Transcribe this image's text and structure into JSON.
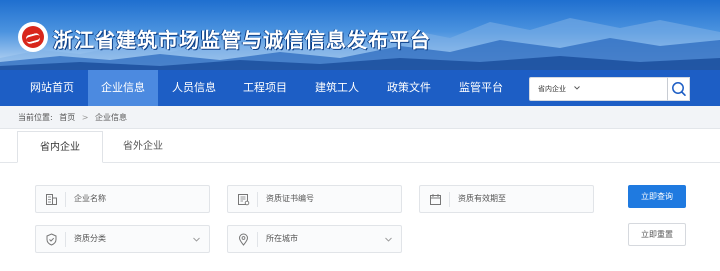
{
  "header": {
    "site_title": "浙江省建筑市场监管与诚信信息发布平台",
    "logo_icon": "zhejiang-emblem-icon",
    "brand_color": "#1d5ec5"
  },
  "nav": {
    "items": [
      {
        "label": "网站首页",
        "active": false
      },
      {
        "label": "企业信息",
        "active": true
      },
      {
        "label": "人员信息",
        "active": false
      },
      {
        "label": "工程项目",
        "active": false
      },
      {
        "label": "建筑工人",
        "active": false
      },
      {
        "label": "政策文件",
        "active": false
      },
      {
        "label": "监管平台",
        "active": false
      }
    ],
    "search": {
      "scope_value": "省内企业",
      "chevron_icon": "chevron-down-icon",
      "button_icon": "search-icon"
    }
  },
  "breadcrumb": {
    "prefix": "当前位置:",
    "home": "首页",
    "separator": ">",
    "current": "企业信息"
  },
  "tabs": [
    {
      "label": "省内企业",
      "active": true
    },
    {
      "label": "省外企业",
      "active": false
    }
  ],
  "filters": {
    "company_name": {
      "placeholder": "企业名称",
      "icon": "building-icon"
    },
    "certificate_no": {
      "placeholder": "资质证书编号",
      "icon": "certificate-icon"
    },
    "validity": {
      "placeholder": "资质有效期至",
      "icon": "calendar-icon"
    },
    "qualification_type": {
      "placeholder": "资质分类",
      "icon": "shield-check-icon"
    },
    "city": {
      "placeholder": "所在城市",
      "icon": "location-pin-icon"
    }
  },
  "actions": {
    "query_label": "立即查询",
    "reset_label": "立即重置",
    "primary_color": "#1f7ae0"
  }
}
